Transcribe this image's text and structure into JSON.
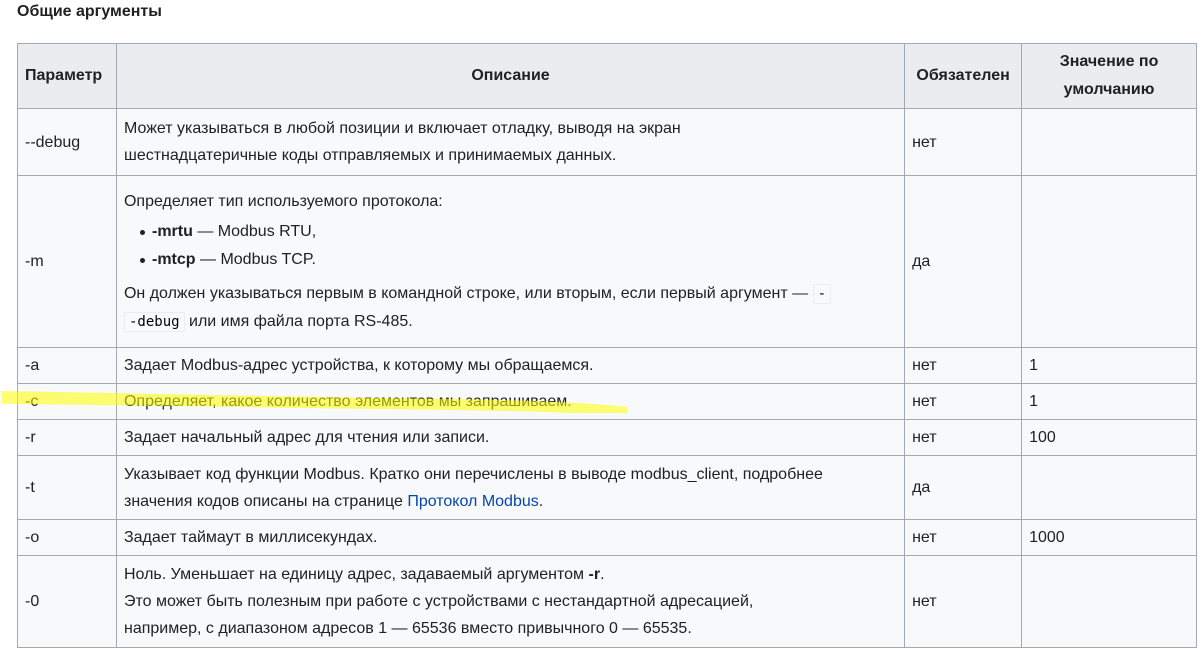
{
  "section": {
    "title": "Общие аргументы"
  },
  "table": {
    "headers": {
      "param": "Параметр",
      "desc": "Описание",
      "req": "Обязателен",
      "def": "Значение по умолчанию"
    },
    "rows": [
      {
        "param": "--debug",
        "desc_lines": [
          "Может указываться в любой позиции и включает отладку, выводя на экран",
          "шестнадцатеричные коды отправляемых и принимаемых данных."
        ],
        "req": "нет",
        "def": ""
      },
      {
        "param": "-m",
        "desc_intro": "Определяет тип используемого протокола:",
        "list": [
          {
            "flag": "-mrtu",
            "text": " — Modbus RTU,"
          },
          {
            "flag": "-mtcp",
            "text": " — Modbus TCP."
          }
        ],
        "desc_outro_before": "Он должен указываться первым в командной строке, или вторым, если первый аргумент — ",
        "desc_code_1": "-",
        "desc_code_2": "-debug",
        "desc_outro_after": " или имя файла порта RS-485.",
        "req": "да",
        "def": ""
      },
      {
        "param": "-a",
        "desc": "Задает Modbus-адрес устройства, к которому мы обращаемся.",
        "req": "нет",
        "def": "1"
      },
      {
        "param": "-c",
        "desc": "Определяет, какое количество элементов мы запрашиваем.",
        "req": "нет",
        "def": "1"
      },
      {
        "param": "-r",
        "desc": "Задает начальный адрес для чтения или записи.",
        "req": "нет",
        "def": "100"
      },
      {
        "param": "-t",
        "desc_line1": "Указывает код функции Modbus. Кратко они перечислены в выводе modbus_client, подробнее",
        "desc_line2_before": "значения кодов описаны на странице ",
        "desc_link": "Протокол Modbus",
        "desc_line2_after": ".",
        "req": "да",
        "def": ""
      },
      {
        "param": "-o",
        "desc": "Задает таймаут в миллисекундах.",
        "req": "нет",
        "def": "1000"
      },
      {
        "param": "-0",
        "desc_line1_before": "Ноль. Уменьшает на единицу адрес, задаваемый аргументом ",
        "desc_line1_flag": "-r",
        "desc_line1_after": ".",
        "desc_line2": "Это может быть полезным при работе с устройствами с нестандартной адресацией,",
        "desc_line3": "например, с диапазоном адресов 1 — 65536 вместо привычного 0 — 65535.",
        "req": "нет",
        "def": ""
      }
    ]
  },
  "highlight_color": "#ffff00"
}
